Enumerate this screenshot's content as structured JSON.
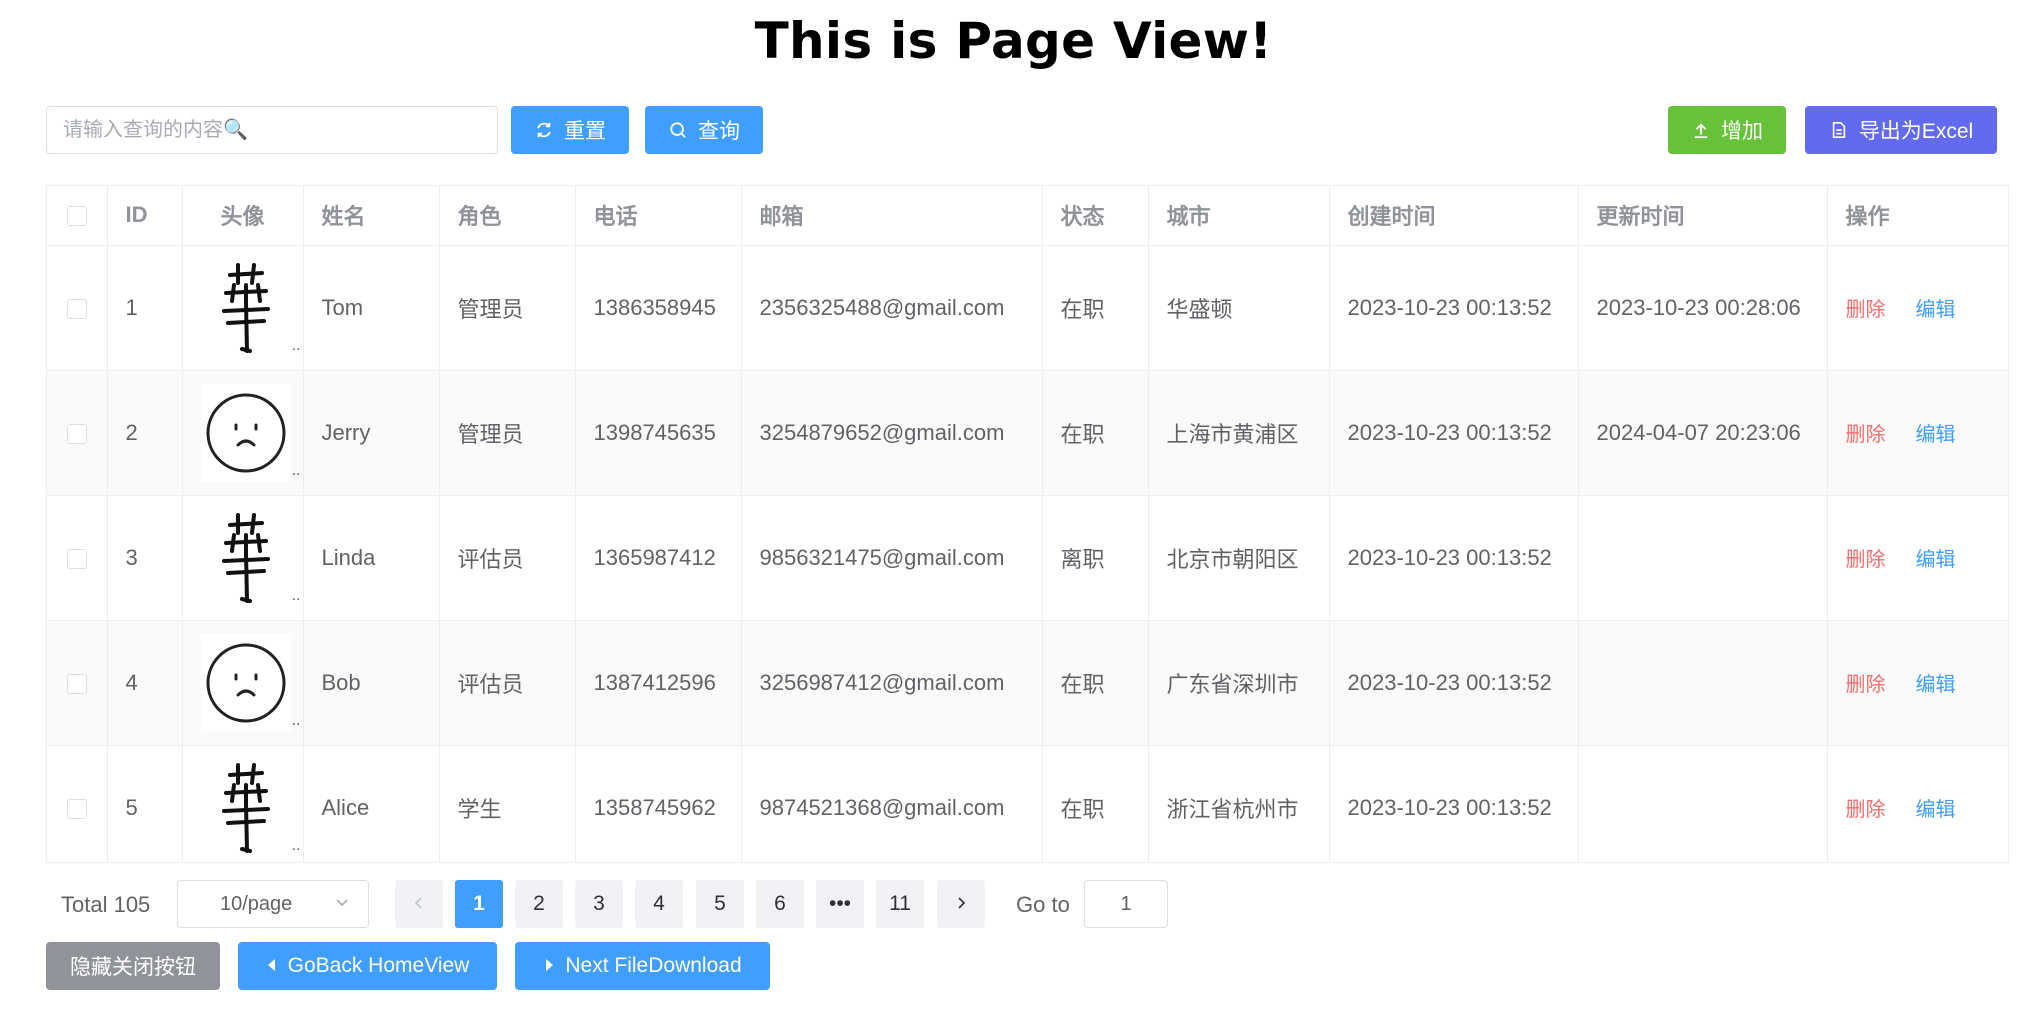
{
  "page_title": "This is Page View!",
  "toolbar": {
    "search_placeholder": "请输入查询的内容🔍",
    "reset_label": "重置",
    "query_label": "查询",
    "add_label": "增加",
    "export_label": "导出为Excel"
  },
  "table": {
    "headers": {
      "id": "ID",
      "avatar": "头像",
      "name": "姓名",
      "role": "角色",
      "phone": "电话",
      "email": "邮箱",
      "status": "状态",
      "city": "城市",
      "created": "创建时间",
      "updated": "更新时间",
      "ops": "操作"
    },
    "rows": [
      {
        "id": "1",
        "avatar": "hua-character",
        "name": "Tom",
        "role": "管理员",
        "phone": "1386358945",
        "email": "2356325488@gmail.com",
        "status": "在职",
        "city": "华盛顿",
        "created": "2023-10-23 00:13:52",
        "updated": "2023-10-23 00:28:06"
      },
      {
        "id": "2",
        "avatar": "sad-face",
        "name": "Jerry",
        "role": "管理员",
        "phone": "1398745635",
        "email": "3254879652@gmail.com",
        "status": "在职",
        "city": "上海市黄浦区",
        "created": "2023-10-23 00:13:52",
        "updated": "2024-04-07 20:23:06"
      },
      {
        "id": "3",
        "avatar": "hua-character",
        "name": "Linda",
        "role": "评估员",
        "phone": "1365987412",
        "email": "9856321475@gmail.com",
        "status": "离职",
        "city": "北京市朝阳区",
        "created": "2023-10-23 00:13:52",
        "updated": ""
      },
      {
        "id": "4",
        "avatar": "sad-face",
        "name": "Bob",
        "role": "评估员",
        "phone": "1387412596",
        "email": "3256987412@gmail.com",
        "status": "在职",
        "city": "广东省深圳市",
        "created": "2023-10-23 00:13:52",
        "updated": ""
      },
      {
        "id": "5",
        "avatar": "hua-character",
        "name": "Alice",
        "role": "学生",
        "phone": "1358745962",
        "email": "9874521368@gmail.com",
        "status": "在职",
        "city": "浙江省杭州市",
        "created": "2023-10-23 00:13:52",
        "updated": ""
      }
    ],
    "avatar_overflow": "..",
    "delete_label": "删除",
    "edit_label": "编辑"
  },
  "pagination": {
    "total": "Total 105",
    "page_size": "10/page",
    "pages": [
      "1",
      "2",
      "3",
      "4",
      "5",
      "6",
      "•••",
      "11"
    ],
    "current": "1",
    "goto_label": "Go to",
    "goto_value": "1"
  },
  "footer": {
    "hide_label": "隐藏关闭按钮",
    "back_label": "GoBack HomeView",
    "next_label": "Next FileDownload"
  },
  "colors": {
    "primary": "#409eff",
    "success": "#67c23a",
    "export": "#626aef",
    "info": "#909399",
    "danger": "#f56c6c"
  }
}
